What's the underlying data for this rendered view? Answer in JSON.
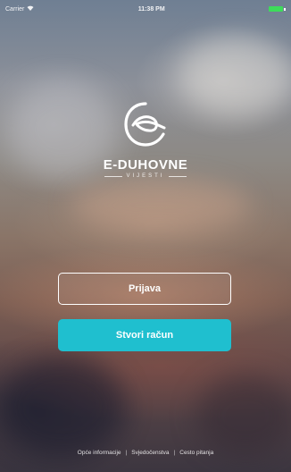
{
  "status_bar": {
    "carrier": "Carrier",
    "time": "11:38 PM",
    "battery_color": "#3ddc5a"
  },
  "brand": {
    "name": "E-DUHOVNE",
    "subtitle": "VIJESTI",
    "logo_icon": "e-duhovne-logo-icon"
  },
  "buttons": {
    "login_label": "Prijava",
    "register_label": "Stvori račun",
    "register_color": "#1fbfcf"
  },
  "footer": {
    "links": [
      "Opće informacije",
      "Svjedočenstva",
      "Cesto pitanja"
    ]
  }
}
